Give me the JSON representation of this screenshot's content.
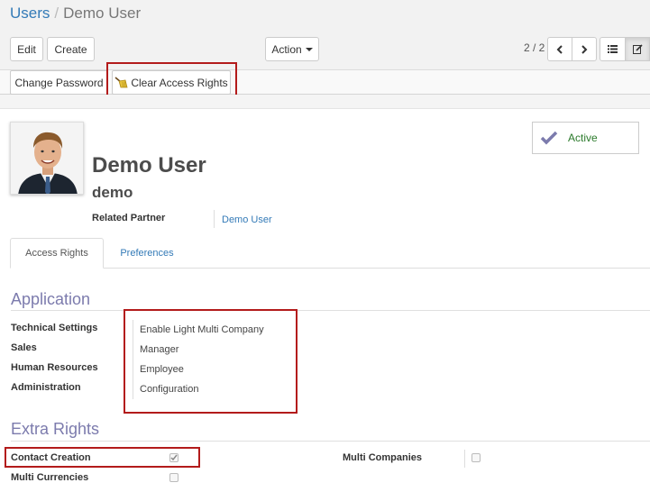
{
  "breadcrumb": {
    "parent": "Users",
    "separator": "/",
    "current": "Demo User"
  },
  "toolbar": {
    "edit_label": "Edit",
    "create_label": "Create",
    "action_label": "Action",
    "pager": "2 / 2"
  },
  "statusbar": {
    "change_password_label": "Change Password",
    "clear_access_rights_label": "Clear Access Rights"
  },
  "record": {
    "name": "Demo User",
    "login": "demo",
    "related_partner_label": "Related Partner",
    "related_partner_value": "Demo User",
    "active_label": "Active"
  },
  "tabs": [
    {
      "label": "Access Rights",
      "active": true
    },
    {
      "label": "Preferences",
      "active": false
    }
  ],
  "application": {
    "title": "Application",
    "groups": [
      {
        "label": "Technical Settings",
        "value": "Enable Light Multi Company"
      },
      {
        "label": "Sales",
        "value": "Manager"
      },
      {
        "label": "Human Resources",
        "value": "Employee"
      },
      {
        "label": "Administration",
        "value": "Configuration"
      }
    ]
  },
  "extra_rights": {
    "title": "Extra Rights",
    "items": [
      {
        "label": "Contact Creation",
        "checked": true
      },
      {
        "label": "Multi Companies",
        "checked": false
      },
      {
        "label": "Multi Currencies",
        "checked": false
      }
    ]
  },
  "colors": {
    "accent": "#7c7bad",
    "link": "#337ab7",
    "active_green": "#2b7a2b",
    "highlight_red": "#b31b1b"
  },
  "icons": {
    "prev": "chevron-left-icon",
    "next": "chevron-right-icon",
    "list_view": "list-icon",
    "form_view": "edit-icon",
    "clear": "broom-icon",
    "active_check": "checkmark-icon"
  }
}
